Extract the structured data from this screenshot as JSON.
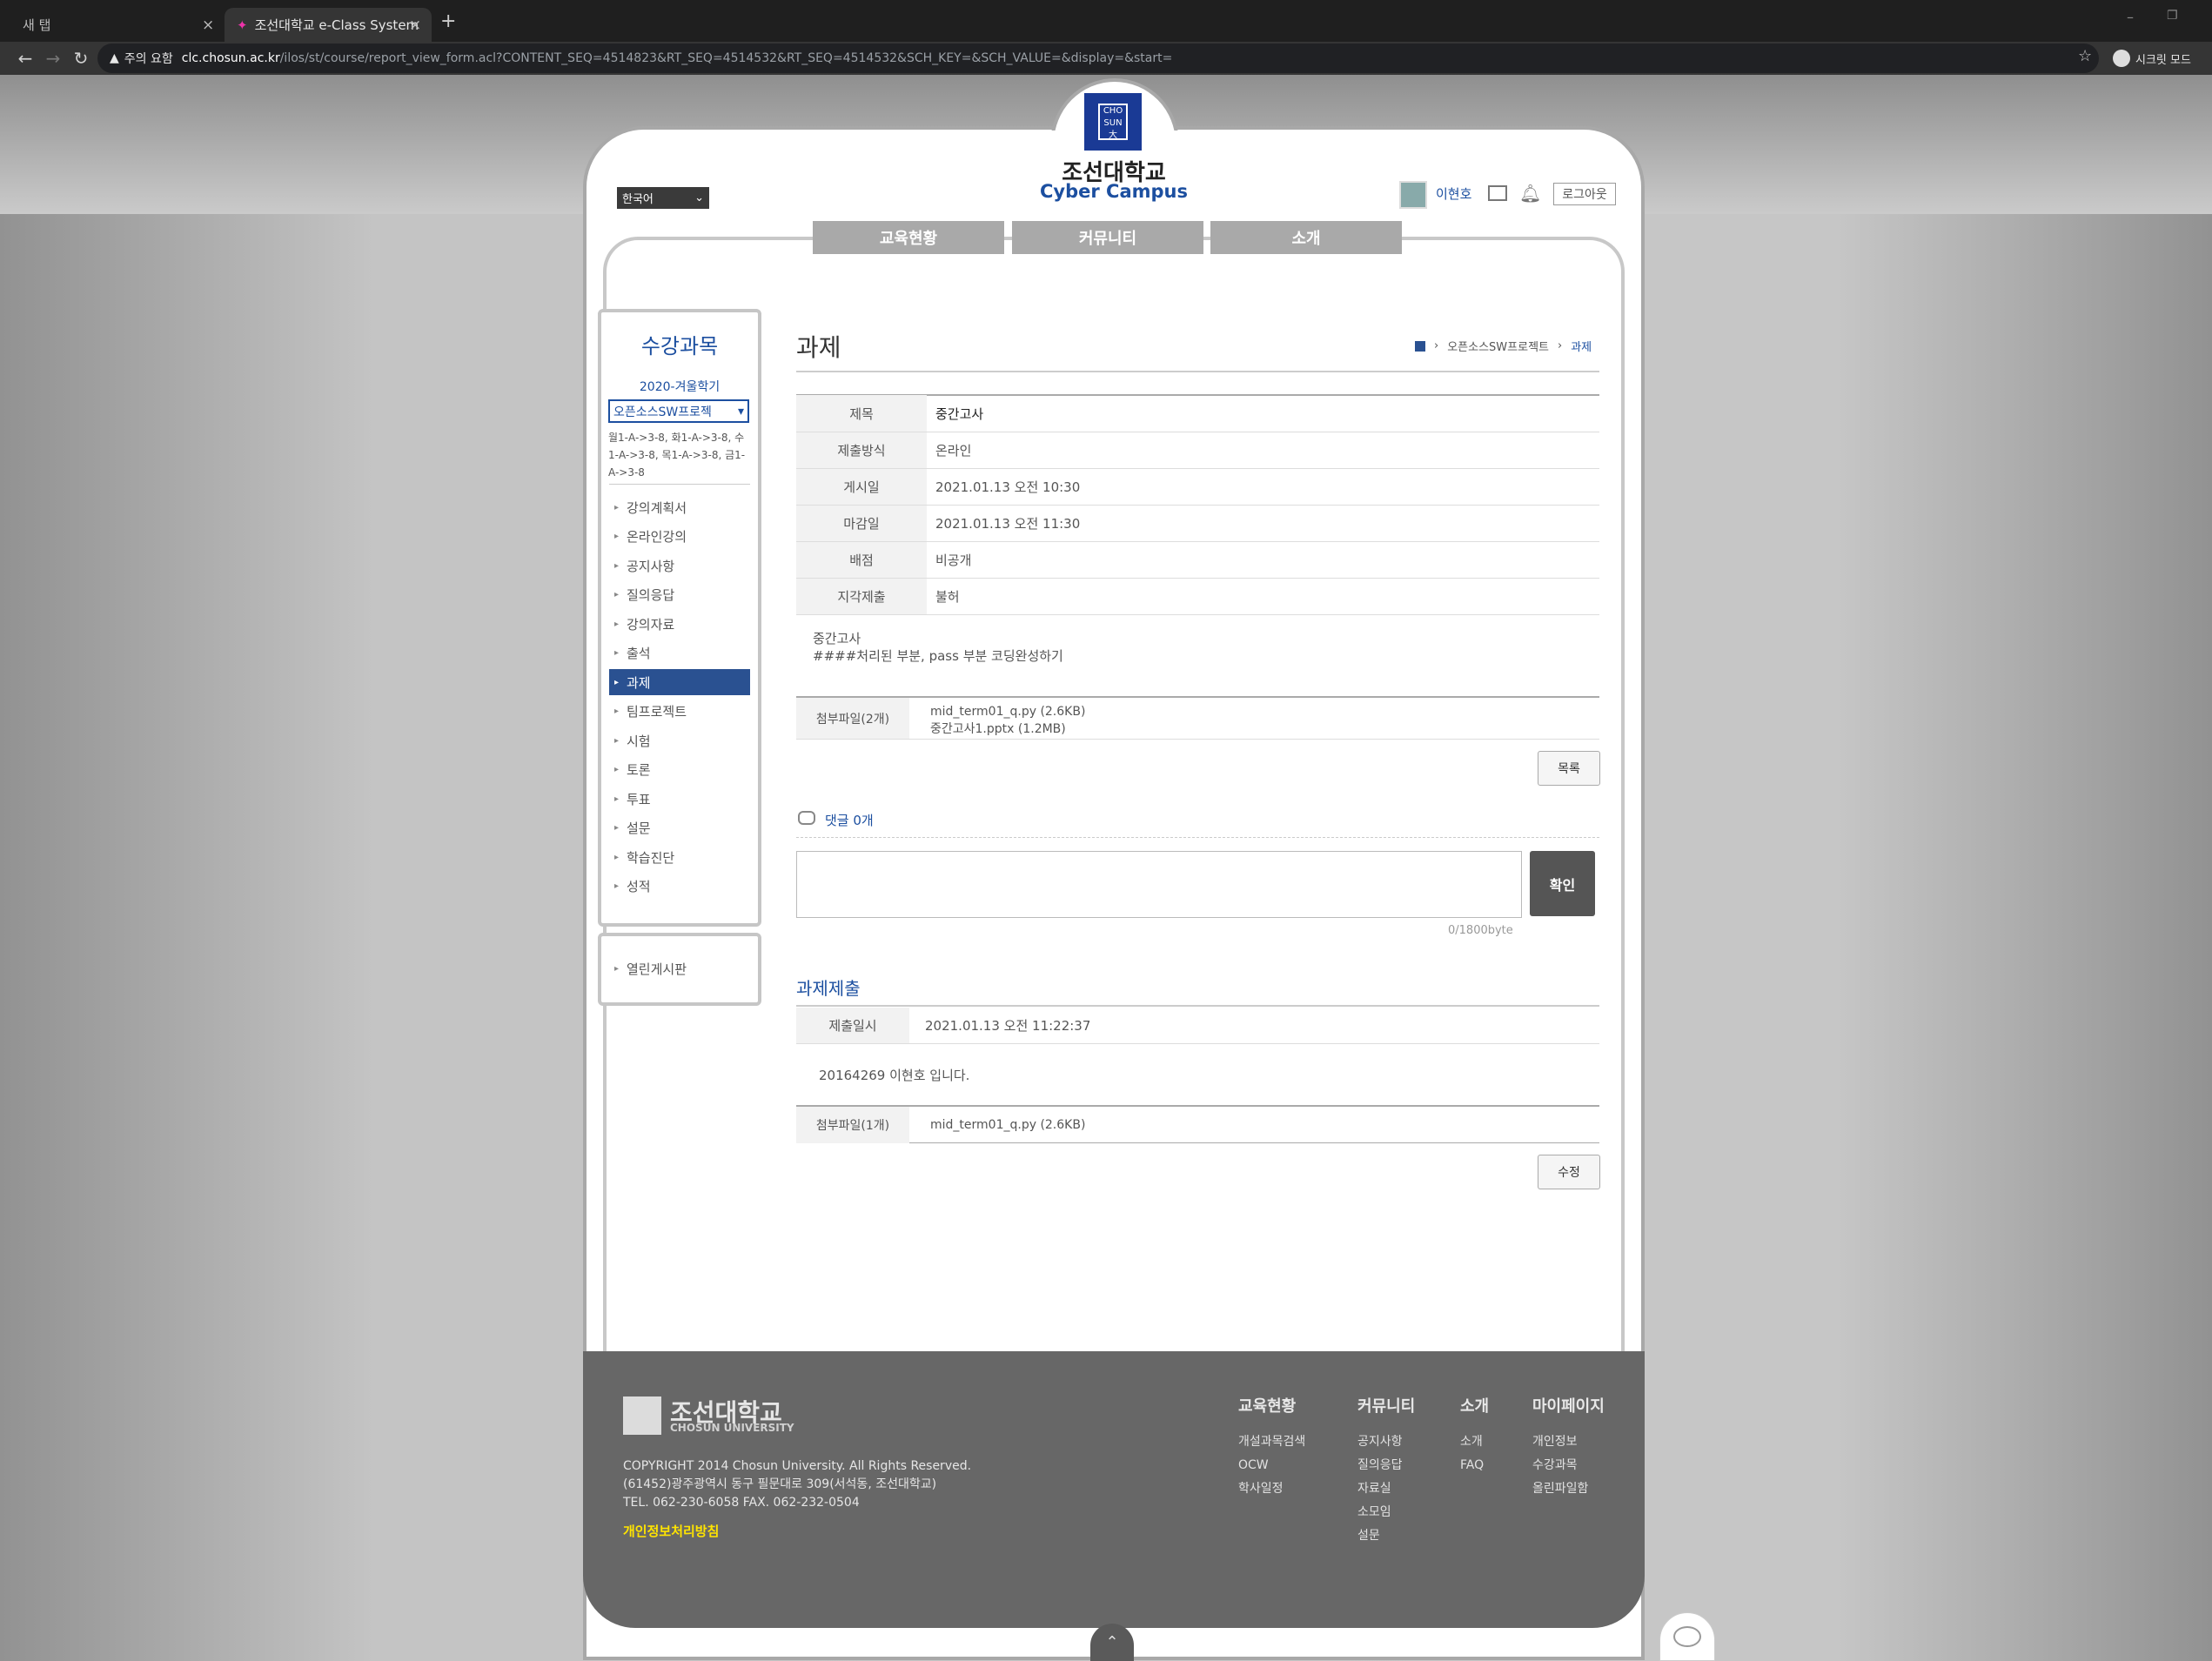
{
  "browser": {
    "tab1": "새 탭",
    "tab2": "조선대학교 e-Class System",
    "security": "주의 요함",
    "url_host": "clc.chosun.ac.kr",
    "url_path": "/ilos/st/course/report_view_form.acl?CONTENT_SEQ=4514823&RT_SEQ=4514532&RT_SEQ=4514532&SCH_KEY=&SCH_VALUE=&display=&start=",
    "incognito": "시크릿 모드"
  },
  "header": {
    "logo_main": "조선대학교",
    "logo_sub": "Cyber Campus",
    "language": "한국어",
    "username": "이현호",
    "logout": "로그아웃"
  },
  "gnb": [
    "교육현황",
    "커뮤니티",
    "소개"
  ],
  "lnb": {
    "title": "수강과목",
    "semester": "2020-겨울학기",
    "course": "오픈소스SW프로젝",
    "schedule": "월1-A->3-8, 화1-A->3-8, 수1-A->3-8, 목1-A->3-8, 금1-A->3-8",
    "items": [
      "강의계획서",
      "온라인강의",
      "공지사항",
      "질의응답",
      "강의자료",
      "출석",
      "과제",
      "팀프로젝트",
      "시험",
      "토론",
      "투표",
      "설문",
      "학습진단",
      "성적"
    ],
    "active": "과제",
    "extra": "열린게시판"
  },
  "content": {
    "title": "과제",
    "breadcrumb": [
      "오픈소스SW프로젝트",
      "과제"
    ],
    "rows": [
      {
        "label": "제목",
        "value": "중간고사"
      },
      {
        "label": "제출방식",
        "value": "온라인"
      },
      {
        "label": "게시일",
        "value": "2021.01.13 오전 10:30"
      },
      {
        "label": "마감일",
        "value": "2021.01.13 오전 11:30"
      },
      {
        "label": "배점",
        "value": "비공개"
      },
      {
        "label": "지각제출",
        "value": "불허"
      }
    ],
    "desc_line1": "중간고사",
    "desc_line2": "####처리된 부분, pass 부분 코딩완성하기",
    "attach_label": "첨부파일(2개)",
    "attach_files": [
      "mid_term01_q.py (2.6KB)",
      "중간고사1.pptx (1.2MB)"
    ],
    "list_btn": "목록",
    "comment_label": "댓글 0개",
    "comment_submit": "확인",
    "comment_count": "0/1800byte",
    "submit_title": "과제제출",
    "submit_date_label": "제출일시",
    "submit_date": "2021.01.13 오전 11:22:37",
    "submit_msg": "20164269 이현호 입니다.",
    "submit_attach_label": "첨부파일(1개)",
    "submit_attach_file": "mid_term01_q.py (2.6KB)",
    "edit_btn": "수정"
  },
  "footer": {
    "logo_main": "조선대학교",
    "logo_sub": "CHOSUN UNIVERSITY",
    "copyright": "COPYRIGHT 2014 Chosun University. All Rights Reserved.",
    "address": "(61452)광주광역시 동구 필문대로 309(서석동, 조선대학교)",
    "tel": "TEL. 062-230-6058 FAX. 062-232-0504",
    "privacy": "개인정보처리방침",
    "cols": [
      {
        "title": "교육현황",
        "links": [
          "개설과목검색",
          "OCW",
          "학사일정"
        ]
      },
      {
        "title": "커뮤니티",
        "links": [
          "공지사항",
          "질의응답",
          "자료실",
          "소모임",
          "설문"
        ]
      },
      {
        "title": "소개",
        "links": [
          "소개",
          "FAQ"
        ]
      },
      {
        "title": "마이페이지",
        "links": [
          "개인정보",
          "수강과목",
          "올린파일함"
        ]
      }
    ]
  }
}
